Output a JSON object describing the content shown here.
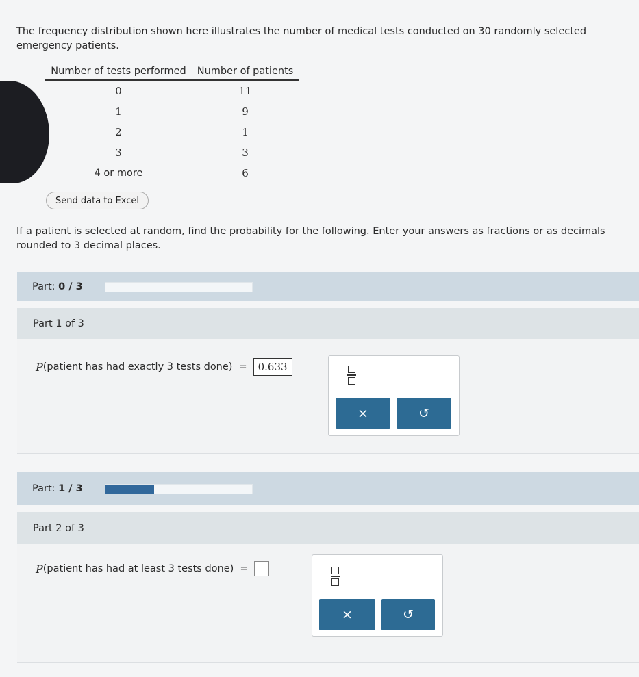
{
  "intro_text": "The frequency distribution shown here illustrates the number of medical tests conducted on 30 randomly selected emergency patients.",
  "table": {
    "headers": [
      "Number of tests performed",
      "Number of patients"
    ],
    "rows": [
      {
        "tests": "0",
        "patients": "11"
      },
      {
        "tests": "1",
        "patients": "9"
      },
      {
        "tests": "2",
        "patients": "1"
      },
      {
        "tests": "3",
        "patients": "3"
      },
      {
        "tests": "4 or more",
        "patients": "6"
      }
    ]
  },
  "excel_button_label": "Send data to Excel",
  "instructions": "If a patient is selected at random, find the probability for the following. Enter your answers as fractions or as decimals rounded to 3 decimal places.",
  "part1": {
    "status_label": "Part:",
    "status_value": "0 / 3",
    "progress_fraction": 0,
    "header": "Part 1 of 3",
    "p_var": "P",
    "question": "(patient has had exactly 3 tests done)",
    "equals": "=",
    "answer": "0.633"
  },
  "part2": {
    "status_label": "Part:",
    "status_value": "1 / 3",
    "progress_fraction": 0.333,
    "header": "Part 2 of 3",
    "p_var": "P",
    "question": "(patient has had at least 3 tests done)",
    "equals": "=",
    "answer": ""
  },
  "tools": {
    "clear_glyph": "×",
    "undo_glyph": "↺",
    "fraction_icon": "fraction-icon",
    "clear_icon": "x-icon",
    "undo_icon": "undo-icon"
  },
  "colors": {
    "status_bar": "#cdd9e2",
    "header_bar": "#dde3e6",
    "tool_button": "#2d6b94",
    "progress_fill": "#31689b"
  }
}
